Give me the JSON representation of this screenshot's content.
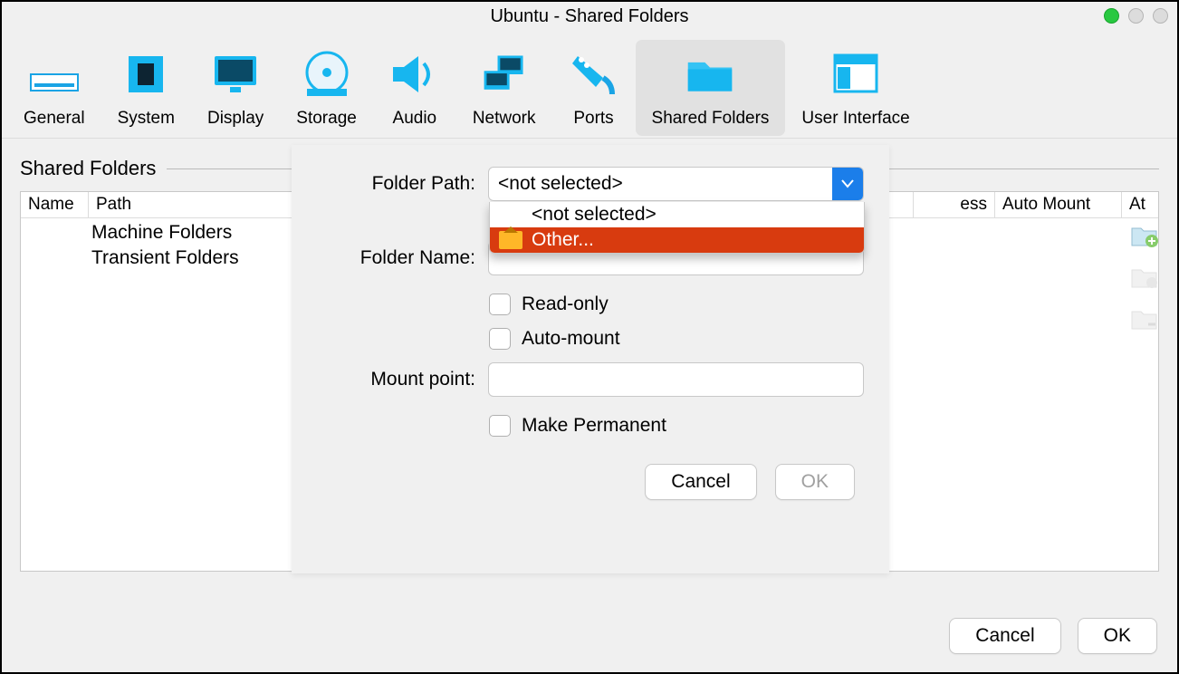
{
  "window": {
    "title": "Ubuntu - Shared Folders"
  },
  "toolbar": {
    "items": [
      {
        "label": "General"
      },
      {
        "label": "System"
      },
      {
        "label": "Display"
      },
      {
        "label": "Storage"
      },
      {
        "label": "Audio"
      },
      {
        "label": "Network"
      },
      {
        "label": "Ports"
      },
      {
        "label": "Shared Folders"
      },
      {
        "label": "User Interface"
      }
    ]
  },
  "section": {
    "title": "Shared Folders"
  },
  "table": {
    "columns": {
      "name": "Name",
      "path": "Path",
      "access": "ess",
      "auto": "Auto Mount",
      "at": "At"
    },
    "rows": [
      {
        "label": "Machine Folders"
      },
      {
        "label": "Transient Folders"
      }
    ]
  },
  "main_buttons": {
    "cancel": "Cancel",
    "ok": "OK"
  },
  "dialog": {
    "folder_path_label": "Folder Path:",
    "folder_path_value": "<not selected>",
    "dropdown": {
      "opt_not_selected": "<not selected>",
      "opt_other": "Other..."
    },
    "folder_name_label": "Folder Name:",
    "folder_name_value": "",
    "readonly_label": "Read-only",
    "automount_label": "Auto-mount",
    "mountpoint_label": "Mount point:",
    "mountpoint_value": "",
    "permanent_label": "Make Permanent",
    "cancel": "Cancel",
    "ok": "OK"
  }
}
